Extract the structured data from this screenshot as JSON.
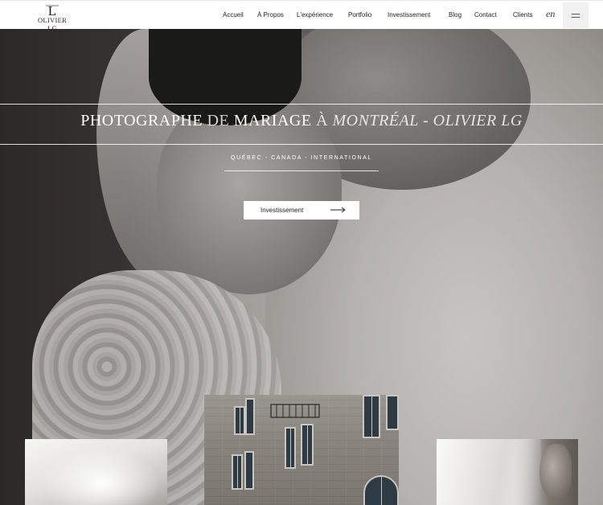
{
  "header": {
    "logo_mark": "L",
    "logo_text": "OLIVIER LG",
    "nav": [
      "Accueil",
      "À Propos",
      "L'expérience",
      "Portfolio",
      "Investissement",
      "Blog",
      "Contact",
      "Clients"
    ],
    "lang": "en"
  },
  "hero": {
    "title_parts": [
      "PHOTOGRAPHE ",
      "DE ",
      "MARIAGE ",
      "À ",
      "MONTRÉAL - OLIVIER LG"
    ],
    "subtitle": "QUÉBEC - CANADA - INTERNATIONAL",
    "cta_label": "Investissement"
  },
  "icons": {
    "menu": "menu-icon",
    "arrow": "arrow-right-icon"
  }
}
